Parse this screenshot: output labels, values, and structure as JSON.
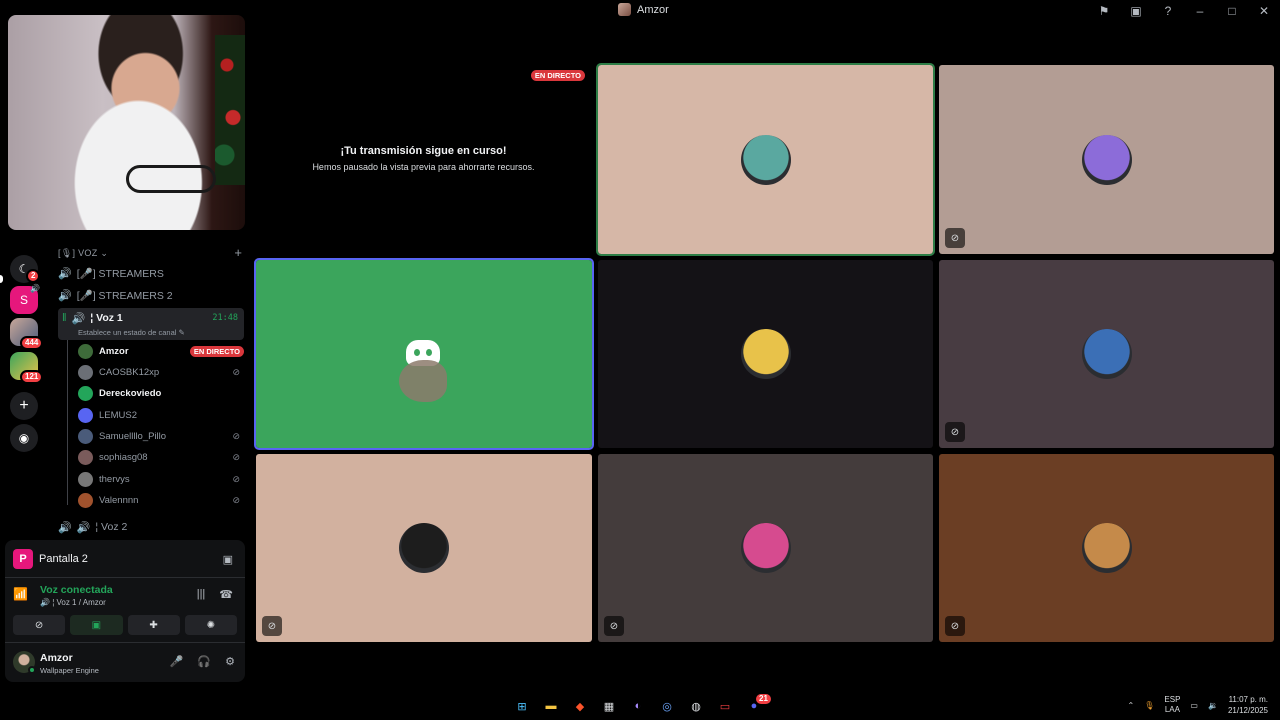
{
  "window": {
    "title": "Amzor",
    "tools": [
      "flag-icon",
      "inbox-icon",
      "help-icon",
      "minimize-icon",
      "maximize-icon",
      "close-icon"
    ]
  },
  "rail": {
    "badges": [
      "2",
      "444",
      "121"
    ],
    "letter": "S"
  },
  "channels": {
    "category": "[🎙] VOZ",
    "items": [
      {
        "name": "[🎤] STREAMERS"
      },
      {
        "name": "[🎤] STREAMERS 2"
      }
    ],
    "active": {
      "name": "¦ Voz 1",
      "time": "21:48",
      "status": "Establece un estado de canal"
    },
    "users": [
      {
        "name": "Amzor",
        "live": "EN DIRECTO",
        "bright": true,
        "color": "#3e6b3a"
      },
      {
        "name": "CAOSBK12xp",
        "muted": true,
        "color": "#6b6f76"
      },
      {
        "name": "Dereckoviedo",
        "bright": true,
        "color": "#23a55a"
      },
      {
        "name": "LEMUS2",
        "color": "#5865f2"
      },
      {
        "name": "Samuellllo_Pillo",
        "muted": true,
        "color": "#4a5b7a"
      },
      {
        "name": "sophiasg08",
        "muted": true,
        "color": "#7a5b5b"
      },
      {
        "name": "thervys",
        "muted": true,
        "color": "#777777"
      },
      {
        "name": "Valennnn",
        "muted": true,
        "color": "#a0522d"
      }
    ],
    "next": {
      "name": "¦ Voz 2"
    }
  },
  "panel": {
    "screen_letter": "P",
    "screen_name": "Pantalla 2",
    "voice_title": "Voz conectada",
    "voice_sub": "¦ Voz 1 / Amzor",
    "user_name": "Amzor",
    "user_activity": "Wallpaper Engine"
  },
  "stage": {
    "live": "EN DIRECTO",
    "paused_title": "¡Tu transmisión sigue en curso!",
    "paused_sub": "Hemos pausado la vista previa para ahorrarte recursos."
  },
  "tiles": [
    {
      "bg": "#d6b7a7",
      "border": "#2d7d46",
      "av": "#5aa8a0",
      "muted": false
    },
    {
      "bg": "#b39d94",
      "border": "",
      "av": "#8c6cd9",
      "muted": true
    },
    {
      "bg": "#3ba55c",
      "border": "#5865f2",
      "discord": true,
      "muted": false
    },
    {
      "bg": "#141216",
      "border": "",
      "av": "#e8c24a",
      "muted": false
    },
    {
      "bg": "#483c42",
      "border": "",
      "av": "#3b6fb6",
      "muted": true
    },
    {
      "bg": "#d2b19f",
      "border": "",
      "av": "#1d1d1d",
      "muted": true
    },
    {
      "bg": "#443c3c",
      "border": "",
      "av": "#d64b8f",
      "muted": true
    },
    {
      "bg": "#6b3e24",
      "border": "",
      "av": "#c58a4a",
      "muted": true
    }
  ],
  "taskbar": {
    "lang_top": "ESP",
    "lang_bottom": "LAA",
    "time": "11:07 p. m.",
    "date": "21/12/2025",
    "discord_badge": "21"
  }
}
